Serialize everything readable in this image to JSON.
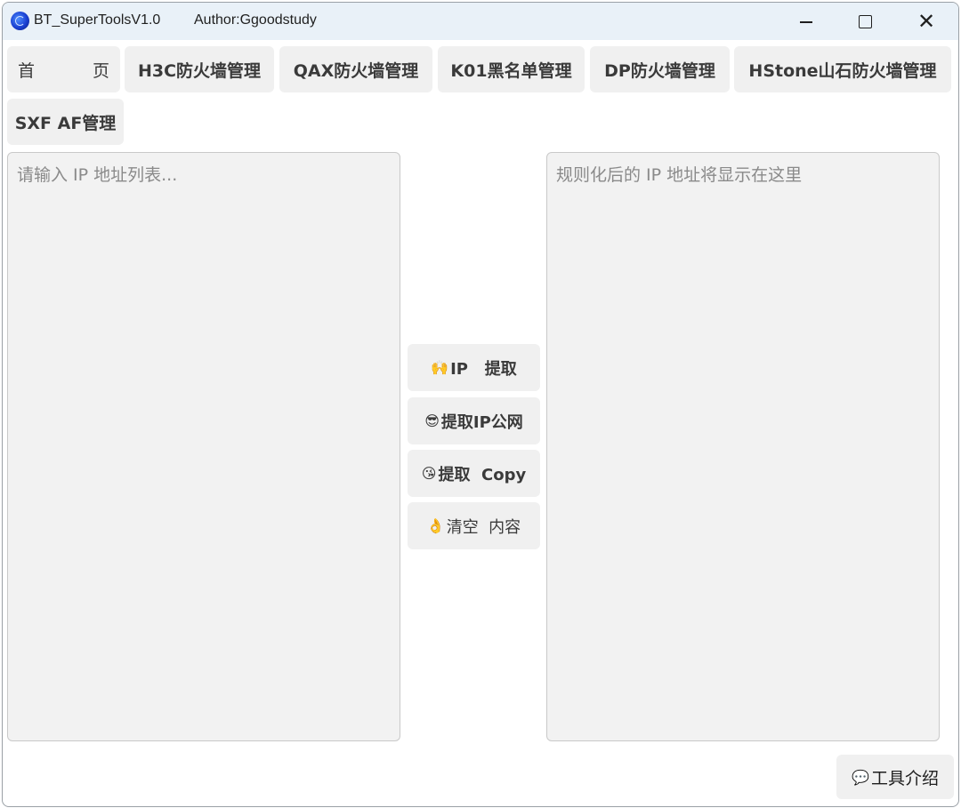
{
  "window": {
    "title": "BT_SuperToolsV1.0",
    "author": "Author:Ggoodstudy",
    "controls": {
      "minimize": "—",
      "maximize": "☐",
      "close": "✕"
    }
  },
  "tabs": [
    {
      "label_a": "首",
      "label_b": "页"
    },
    {
      "label": "H3C防火墙管理"
    },
    {
      "label": "QAX防火墙管理"
    },
    {
      "label": "K01黑名单管理"
    },
    {
      "label": "DP防火墙管理"
    },
    {
      "label": "HStone山石防火墙管理"
    },
    {
      "label": "SXF AF管理"
    }
  ],
  "input_area": {
    "placeholder": "请输入 IP 地址列表..."
  },
  "output_area": {
    "placeholder": "规则化后的 IP 地址将显示在这里"
  },
  "actions": [
    {
      "emoji": "🙌",
      "label": "IP   提取",
      "icon": "raised-hands-icon"
    },
    {
      "emoji": "😎",
      "label": "提取IP公网",
      "icon": "sunglasses-face-icon"
    },
    {
      "emoji": "😘",
      "label": "提取  Copy",
      "icon": "kiss-face-icon"
    },
    {
      "emoji": "👌",
      "label": "清空  内容",
      "icon": "ok-hand-icon"
    }
  ],
  "footer": {
    "tool_intro_label": "工具介绍",
    "tool_intro_emoji": "💬"
  },
  "colors": {
    "titlebar_bg": "#e9f1f8",
    "button_bg": "#f0f0f0",
    "text_area_bg": "#f2f2f2",
    "text_primary": "#3a3a3a"
  }
}
